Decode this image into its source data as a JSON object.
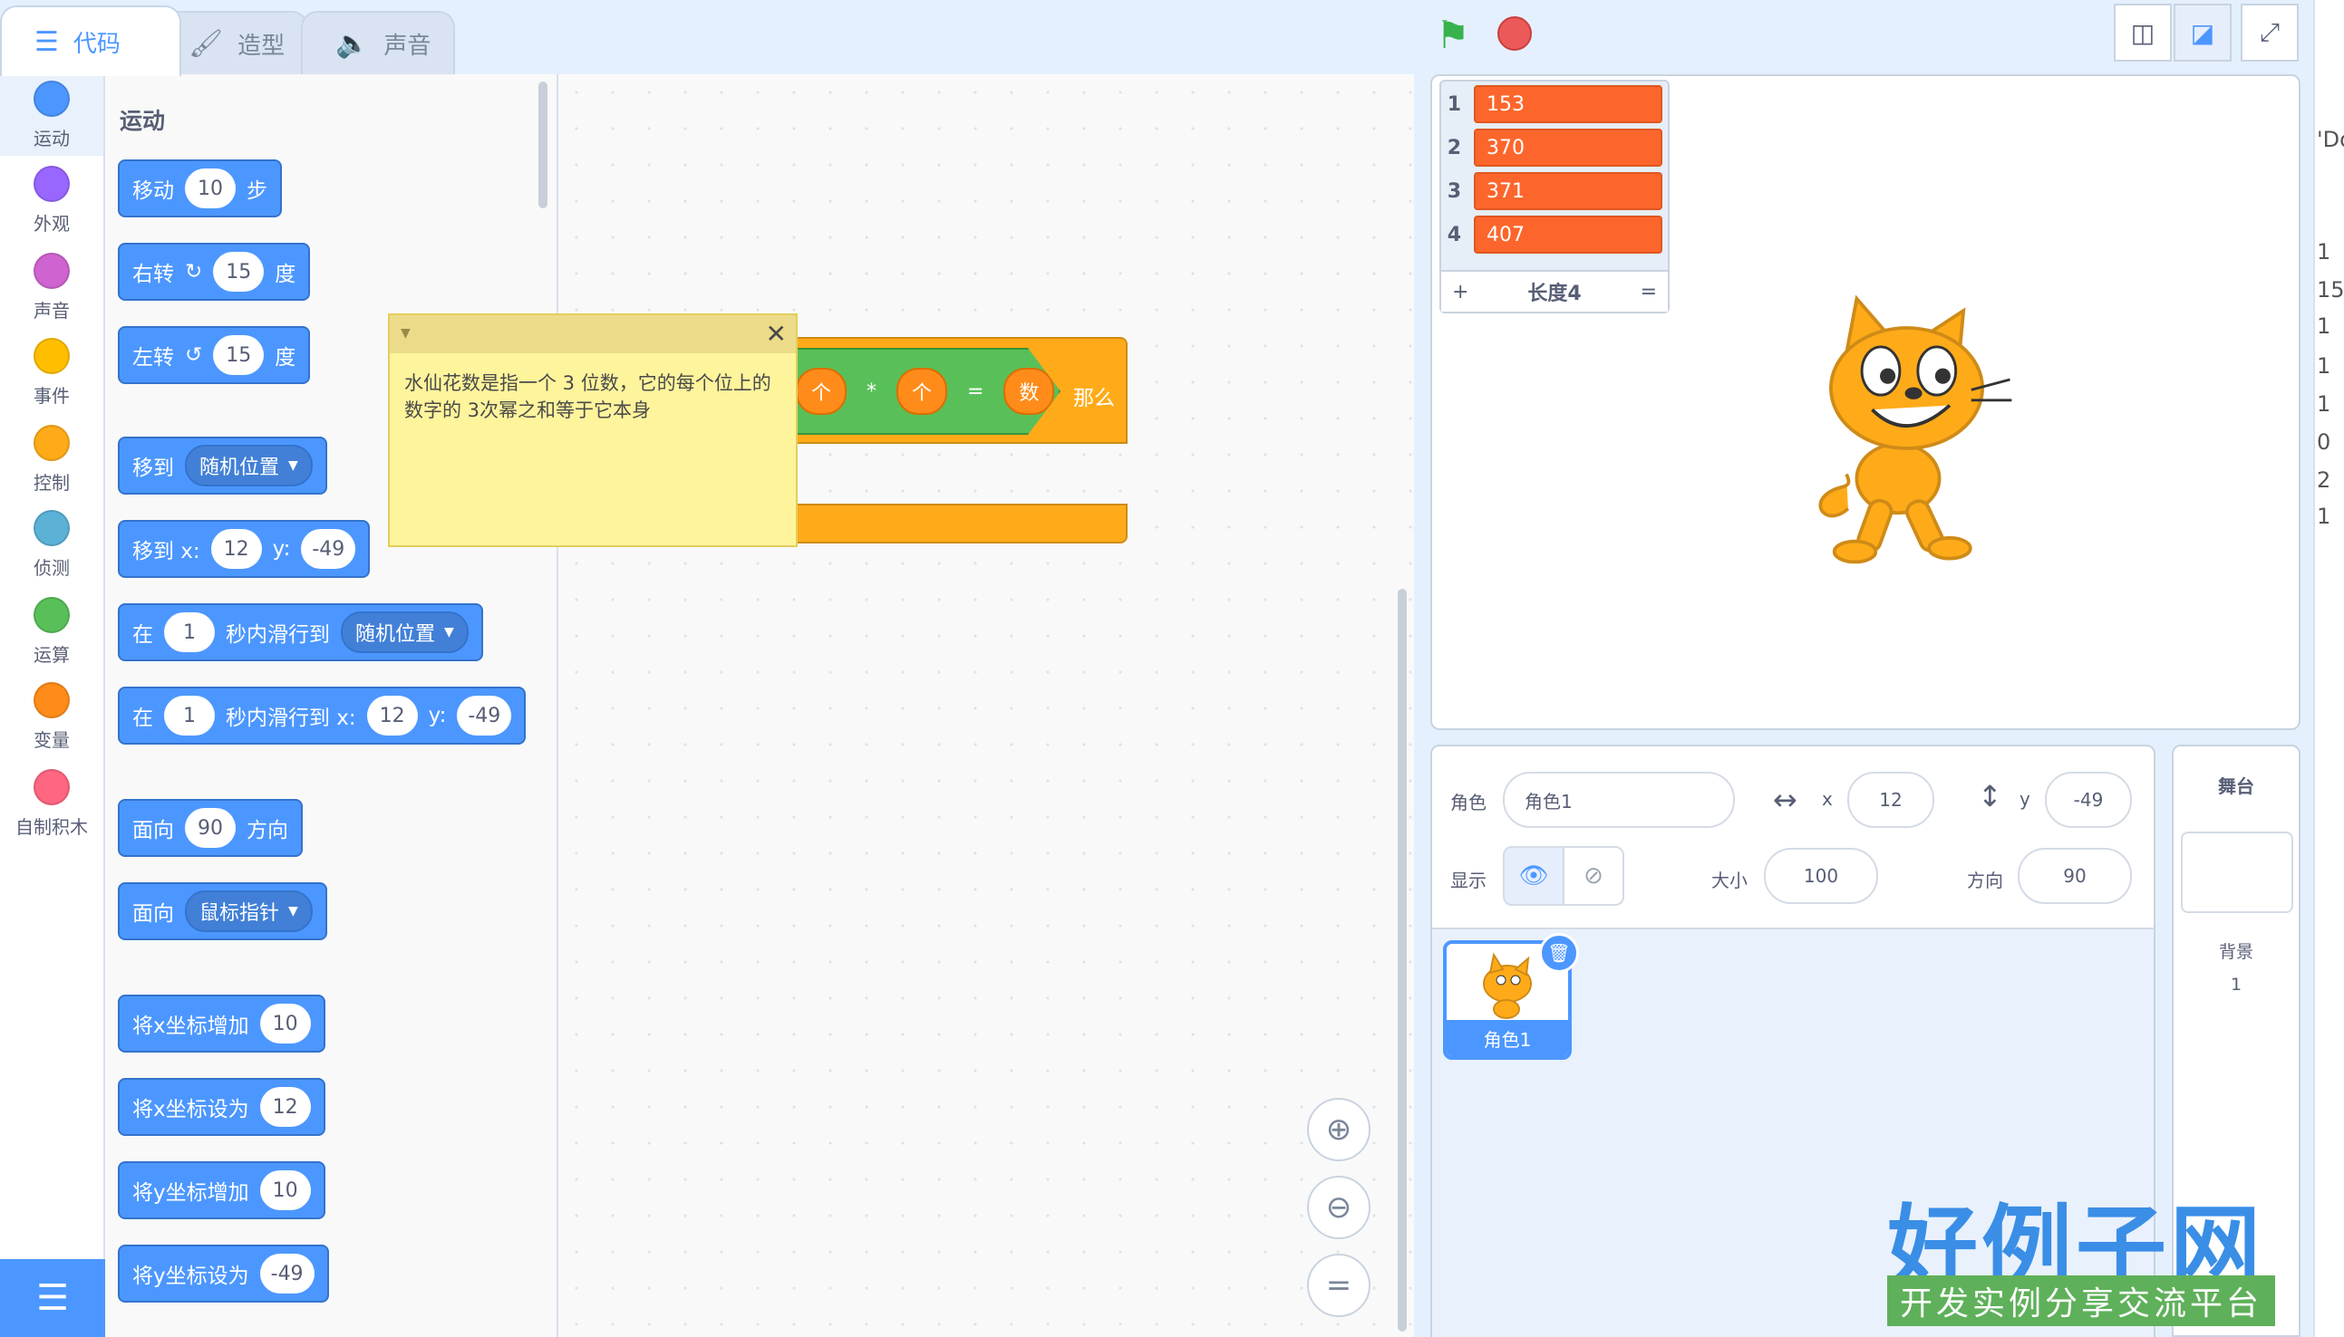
{
  "tabs": [
    {
      "label": "代码",
      "icon": "code-icon"
    },
    {
      "label": "造型",
      "icon": "brush-icon"
    },
    {
      "label": "声音",
      "icon": "speaker-icon"
    }
  ],
  "categories": [
    {
      "label": "运动",
      "color": "#4c97ff"
    },
    {
      "label": "外观",
      "color": "#9966ff"
    },
    {
      "label": "声音",
      "color": "#cf63cf"
    },
    {
      "label": "事件",
      "color": "#ffbf00"
    },
    {
      "label": "控制",
      "color": "#ffab19"
    },
    {
      "label": "侦测",
      "color": "#5cb1d6"
    },
    {
      "label": "运算",
      "color": "#59c059"
    },
    {
      "label": "变量",
      "color": "#ff8c1a"
    },
    {
      "label": "自制积木",
      "color": "#ff6680"
    }
  ],
  "palette": {
    "title": "运动",
    "blocks": {
      "move": {
        "a": "移动",
        "n": "10",
        "b": "步"
      },
      "turn_right": {
        "a": "右转",
        "n": "15",
        "b": "度"
      },
      "turn_left": {
        "a": "左转",
        "n": "15",
        "b": "度"
      },
      "goto": {
        "a": "移到",
        "dd": "随机位置"
      },
      "goto_xy": {
        "a": "移到 x:",
        "x": "12",
        "b": "y:",
        "y": "-49"
      },
      "glide": {
        "a": "在",
        "n": "1",
        "b": "秒内滑行到",
        "dd": "随机位置"
      },
      "glide_xy": {
        "a": "在",
        "n": "1",
        "b": "秒内滑行到 x:",
        "x": "12",
        "c": "y:",
        "y": "-49"
      },
      "point_dir": {
        "a": "面向",
        "n": "90",
        "b": "方向"
      },
      "point_towards": {
        "a": "面向",
        "dd": "鼠标指针"
      },
      "change_x": {
        "a": "将x坐标增加",
        "n": "10"
      },
      "set_x": {
        "a": "将x坐标设为",
        "n": "12"
      },
      "change_y": {
        "a": "将y坐标增加",
        "n": "10"
      },
      "set_y": {
        "a": "将y坐标设为",
        "n": "-49"
      }
    }
  },
  "script": {
    "cond_ops": [
      "个",
      "*",
      "个",
      "=",
      "数"
    ],
    "then_label": "那么",
    "comment": "水仙花数是指一个 3 位数，它的每个位上的数字的 3次幂之和等于它本身"
  },
  "stage_list": {
    "items": [
      "153",
      "370",
      "371",
      "407"
    ],
    "indices": [
      "1",
      "2",
      "3",
      "4"
    ],
    "add": "+",
    "length_label": "长度4",
    "resize": "="
  },
  "sprite_info": {
    "sprite_label": "角色",
    "sprite_name": "角色1",
    "x_label": "x",
    "x": "12",
    "y_label": "y",
    "y": "-49",
    "show_label": "显示",
    "size_label": "大小",
    "size": "100",
    "direction_label": "方向",
    "direction": "90"
  },
  "sprites": [
    {
      "name": "角色1"
    }
  ],
  "stage_pane": {
    "title": "舞台",
    "backdrop_label": "背景",
    "backdrop_count": "1"
  },
  "watermark": {
    "logo": "好例子网",
    "sub": "开发实例分享交流平台"
  },
  "edge_text": [
    "'Do",
    "1",
    "15",
    "1",
    "1",
    "1",
    "0",
    "2",
    "1"
  ]
}
